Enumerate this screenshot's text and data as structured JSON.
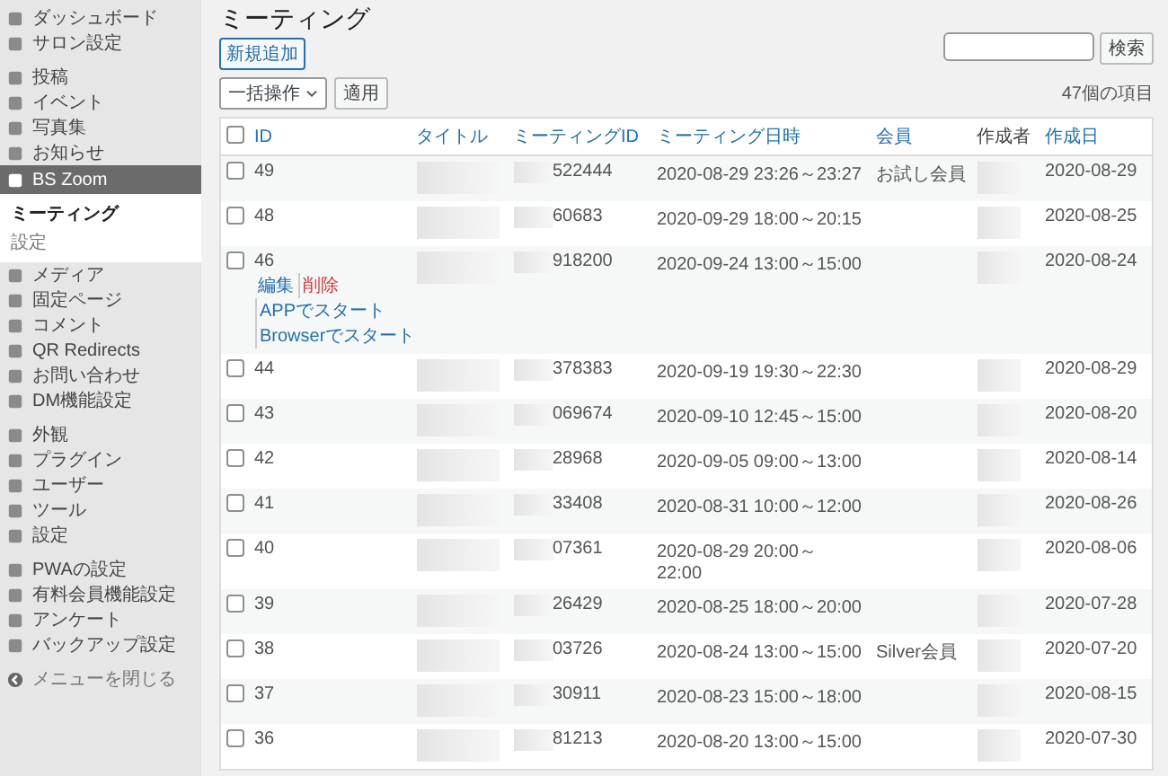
{
  "sidebar": {
    "groups": [
      [
        {
          "label": "ダッシュボード",
          "selected": false
        },
        {
          "label": "サロン設定",
          "selected": false
        }
      ],
      [
        {
          "label": "投稿",
          "selected": false
        },
        {
          "label": "イベント",
          "selected": false
        },
        {
          "label": "写真集",
          "selected": false
        },
        {
          "label": "お知らせ",
          "selected": false
        },
        {
          "label": "BS Zoom",
          "selected": true,
          "children": [
            {
              "label": "ミーティング",
              "selected": true
            },
            {
              "label": "設定",
              "selected": false
            }
          ]
        },
        {
          "label": "メディア",
          "selected": false
        },
        {
          "label": "固定ページ",
          "selected": false
        },
        {
          "label": "コメント",
          "selected": false
        },
        {
          "label": "QR Redirects",
          "selected": false
        },
        {
          "label": "お問い合わせ",
          "selected": false
        },
        {
          "label": "DM機能設定",
          "selected": false
        }
      ],
      [
        {
          "label": "外観",
          "selected": false
        },
        {
          "label": "プラグイン",
          "selected": false
        },
        {
          "label": "ユーザー",
          "selected": false
        },
        {
          "label": "ツール",
          "selected": false
        },
        {
          "label": "設定",
          "selected": false
        }
      ],
      [
        {
          "label": "PWAの設定",
          "selected": false
        },
        {
          "label": "有料会員機能設定",
          "selected": false
        },
        {
          "label": "アンケート",
          "selected": false
        },
        {
          "label": "バックアップ設定",
          "selected": false
        }
      ]
    ],
    "collapse": "メニューを閉じる"
  },
  "page": {
    "title": "ミーティング",
    "add_button": "新規追加",
    "bulk_action": "一括操作",
    "apply_button": "適用",
    "search_button": "検索",
    "item_count": "47個の項目"
  },
  "table": {
    "select_all_checked": false,
    "columns": [
      {
        "label": "ID",
        "sortable": true
      },
      {
        "label": "タイトル",
        "sortable": true
      },
      {
        "label": "ミーティングID",
        "sortable": true
      },
      {
        "label": "ミーティング日時",
        "sortable": true
      },
      {
        "label": "会員",
        "sortable": true
      },
      {
        "label": "作成者",
        "sortable": false
      },
      {
        "label": "作成日",
        "sortable": true
      }
    ],
    "rows": [
      {
        "checked": false,
        "id": "49",
        "meeting_id": "522444",
        "datetime": "2020-08-29 23:26～23:27",
        "member": "お試し会員",
        "created": "2020-08-29"
      },
      {
        "checked": false,
        "id": "48",
        "meeting_id": "60683",
        "datetime": "2020-09-29 18:00～20:15",
        "member": "",
        "created": "2020-08-25"
      },
      {
        "checked": false,
        "id": "46",
        "meeting_id": "918200",
        "datetime": "2020-09-24 13:00～15:00",
        "member": "",
        "created": "2020-08-24",
        "actions": [
          {
            "label": "編集",
            "kind": "link"
          },
          {
            "label": "削除",
            "kind": "danger"
          },
          {
            "label": "APPでスタート",
            "kind": "link"
          },
          {
            "label": "Browserでスタート",
            "kind": "link"
          }
        ]
      },
      {
        "checked": false,
        "id": "44",
        "meeting_id": "378383",
        "datetime": "2020-09-19 19:30～22:30",
        "member": "",
        "created": "2020-08-29"
      },
      {
        "checked": false,
        "id": "43",
        "meeting_id": "069674",
        "datetime": "2020-09-10 12:45～15:00",
        "member": "",
        "created": "2020-08-20"
      },
      {
        "checked": false,
        "id": "42",
        "meeting_id": "28968",
        "datetime": "2020-09-05 09:00～13:00",
        "member": "",
        "created": "2020-08-14"
      },
      {
        "checked": false,
        "id": "41",
        "meeting_id": "33408",
        "datetime": "2020-08-31 10:00～12:00",
        "member": "",
        "created": "2020-08-26"
      },
      {
        "checked": false,
        "id": "40",
        "meeting_id": "07361",
        "datetime": "2020-08-29 20:00～\n22:00",
        "member": "",
        "created": "2020-08-06"
      },
      {
        "checked": false,
        "id": "39",
        "meeting_id": "26429",
        "datetime": "2020-08-25 18:00～20:00",
        "member": "",
        "created": "2020-07-28"
      },
      {
        "checked": false,
        "id": "38",
        "meeting_id": "03726",
        "datetime": "2020-08-24 13:00～15:00",
        "member": "Silver会員",
        "created": "2020-07-20"
      },
      {
        "checked": false,
        "id": "37",
        "meeting_id": "30911",
        "datetime": "2020-08-23 15:00～18:00",
        "member": "",
        "created": "2020-08-15"
      },
      {
        "checked": false,
        "id": "36",
        "meeting_id": "81213",
        "datetime": "2020-08-20 13:00～15:00",
        "member": "",
        "created": "2020-07-30"
      }
    ]
  }
}
